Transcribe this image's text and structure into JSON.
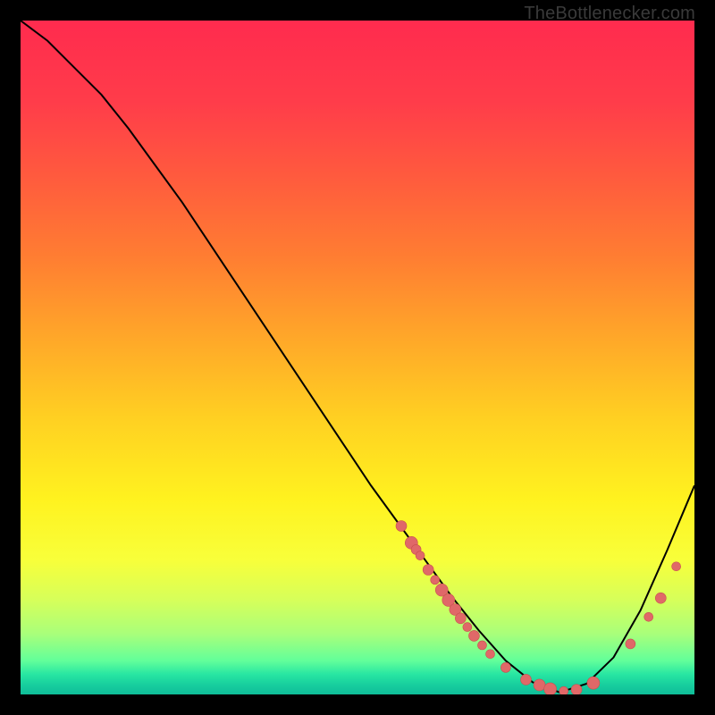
{
  "brand": "TheBottlenecker.com",
  "colors": {
    "line": "#000000",
    "dot_fill": "#e06868",
    "dot_stroke": "#c94f4f"
  },
  "chart_data": {
    "type": "line",
    "title": "",
    "xlabel": "",
    "ylabel": "",
    "xlim": [
      0,
      100
    ],
    "ylim": [
      0,
      100
    ],
    "series": [
      {
        "name": "curve",
        "x": [
          0,
          4,
          8,
          12,
          16,
          20,
          24,
          28,
          32,
          36,
          40,
          44,
          48,
          52,
          56,
          60,
          64,
          68,
          72,
          76,
          80,
          84,
          88,
          92,
          96,
          100
        ],
        "y": [
          100,
          97,
          93,
          89,
          84,
          78.5,
          73,
          67,
          61,
          55,
          49,
          43,
          37,
          31,
          25.5,
          20,
          14.5,
          9.5,
          5,
          1.8,
          0.3,
          1.6,
          5.5,
          12.5,
          21.5,
          31
        ]
      },
      {
        "name": "dots",
        "points": [
          {
            "x": 56.5,
            "y": 25,
            "r": 6
          },
          {
            "x": 58,
            "y": 22.5,
            "r": 7
          },
          {
            "x": 58.7,
            "y": 21.5,
            "r": 5.5
          },
          {
            "x": 59.3,
            "y": 20.6,
            "r": 5
          },
          {
            "x": 60.5,
            "y": 18.5,
            "r": 6
          },
          {
            "x": 61.5,
            "y": 17,
            "r": 5
          },
          {
            "x": 62.5,
            "y": 15.5,
            "r": 7
          },
          {
            "x": 63.5,
            "y": 14,
            "r": 7
          },
          {
            "x": 64.5,
            "y": 12.6,
            "r": 6.5
          },
          {
            "x": 65.3,
            "y": 11.3,
            "r": 6
          },
          {
            "x": 66.3,
            "y": 10,
            "r": 5
          },
          {
            "x": 67.3,
            "y": 8.7,
            "r": 6
          },
          {
            "x": 68.5,
            "y": 7.3,
            "r": 5
          },
          {
            "x": 69.7,
            "y": 6,
            "r": 5
          },
          {
            "x": 72,
            "y": 4,
            "r": 5.5
          },
          {
            "x": 75,
            "y": 2.2,
            "r": 6
          },
          {
            "x": 77,
            "y": 1.4,
            "r": 6.5
          },
          {
            "x": 78.6,
            "y": 0.8,
            "r": 7
          },
          {
            "x": 80.6,
            "y": 0.5,
            "r": 5
          },
          {
            "x": 82.5,
            "y": 0.7,
            "r": 6
          },
          {
            "x": 85,
            "y": 1.7,
            "r": 7
          },
          {
            "x": 90.5,
            "y": 7.5,
            "r": 5.5
          },
          {
            "x": 93.2,
            "y": 11.5,
            "r": 5
          },
          {
            "x": 95,
            "y": 14.3,
            "r": 6
          },
          {
            "x": 97.3,
            "y": 19,
            "r": 5
          }
        ]
      }
    ]
  }
}
